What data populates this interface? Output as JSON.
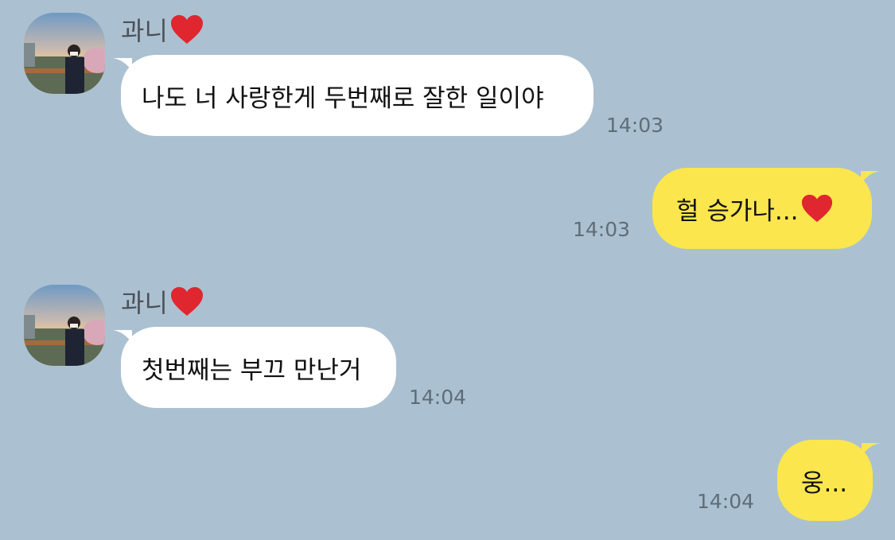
{
  "messages": [
    {
      "sender": "과니",
      "text": "나도 너 사랑한게 두번째로 잘한 일이야",
      "time": "14:03",
      "direction": "in"
    },
    {
      "text": "헐 승가나...",
      "time": "14:03",
      "direction": "out",
      "emoji": "heart"
    },
    {
      "sender": "과니",
      "text": "첫번째는 부끄 만난거",
      "time": "14:04",
      "direction": "in"
    },
    {
      "text": "웅...",
      "time": "14:04",
      "direction": "out"
    }
  ],
  "colors": {
    "background": "#abc1d1",
    "incoming_bubble": "#ffffff",
    "outgoing_bubble": "#fbe64d",
    "heart": "#e0262f"
  },
  "icons": {
    "sender_name_emoji": "red-heart-icon",
    "avatar": "profile-photo"
  }
}
